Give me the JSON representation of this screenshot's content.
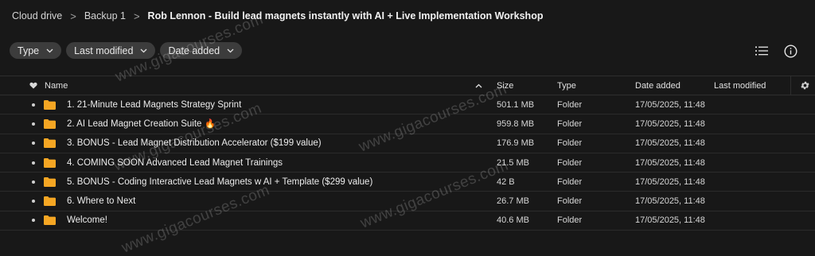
{
  "breadcrumb": {
    "items": [
      "Cloud drive",
      "Backup 1"
    ],
    "current": "Rob Lennon - Build lead magnets instantly with AI + Live Implementation Workshop",
    "separator": ">"
  },
  "filters": {
    "type_label": "Type",
    "last_modified_label": "Last modified",
    "date_added_label": "Date added"
  },
  "toolbar": {
    "list_view_icon": "list-view-icon",
    "info_icon": "info-icon"
  },
  "table": {
    "columns": {
      "name": "Name",
      "size": "Size",
      "type": "Type",
      "date_added": "Date added",
      "last_modified": "Last modified"
    },
    "rows": [
      {
        "name": "1. 21-Minute Lead Magnets Strategy Sprint",
        "size": "501.1 MB",
        "type": "Folder",
        "date_added": "17/05/2025, 11:48",
        "last_modified": ""
      },
      {
        "name": "2. AI Lead Magnet Creation Suite",
        "size": "959.8 MB",
        "type": "Folder",
        "date_added": "17/05/2025, 11:48",
        "last_modified": ""
      },
      {
        "name": "3. BONUS - Lead Magnet Distribution Accelerator ($199 value)",
        "size": "176.9 MB",
        "type": "Folder",
        "date_added": "17/05/2025, 11:48",
        "last_modified": ""
      },
      {
        "name": "4. COMING SOON Advanced Lead Magnet Trainings",
        "size": "21.5 MB",
        "type": "Folder",
        "date_added": "17/05/2025, 11:48",
        "last_modified": ""
      },
      {
        "name": "5. BONUS - Coding Interactive Lead Magnets w AI + Template ($299 value)",
        "size": "42 B",
        "type": "Folder",
        "date_added": "17/05/2025, 11:48",
        "last_modified": ""
      },
      {
        "name": "6. Where to Next",
        "size": "26.7 MB",
        "type": "Folder",
        "date_added": "17/05/2025, 11:48",
        "last_modified": ""
      },
      {
        "name": "Welcome!",
        "size": "40.6 MB",
        "type": "Folder",
        "date_added": "17/05/2025, 11:48",
        "last_modified": ""
      }
    ],
    "fire_emoji": "🔥"
  },
  "watermark": {
    "text": "www.gigacourses.com"
  },
  "colors": {
    "background": "#181818",
    "chip": "#3c3c3c",
    "folder": "#f5a623"
  }
}
